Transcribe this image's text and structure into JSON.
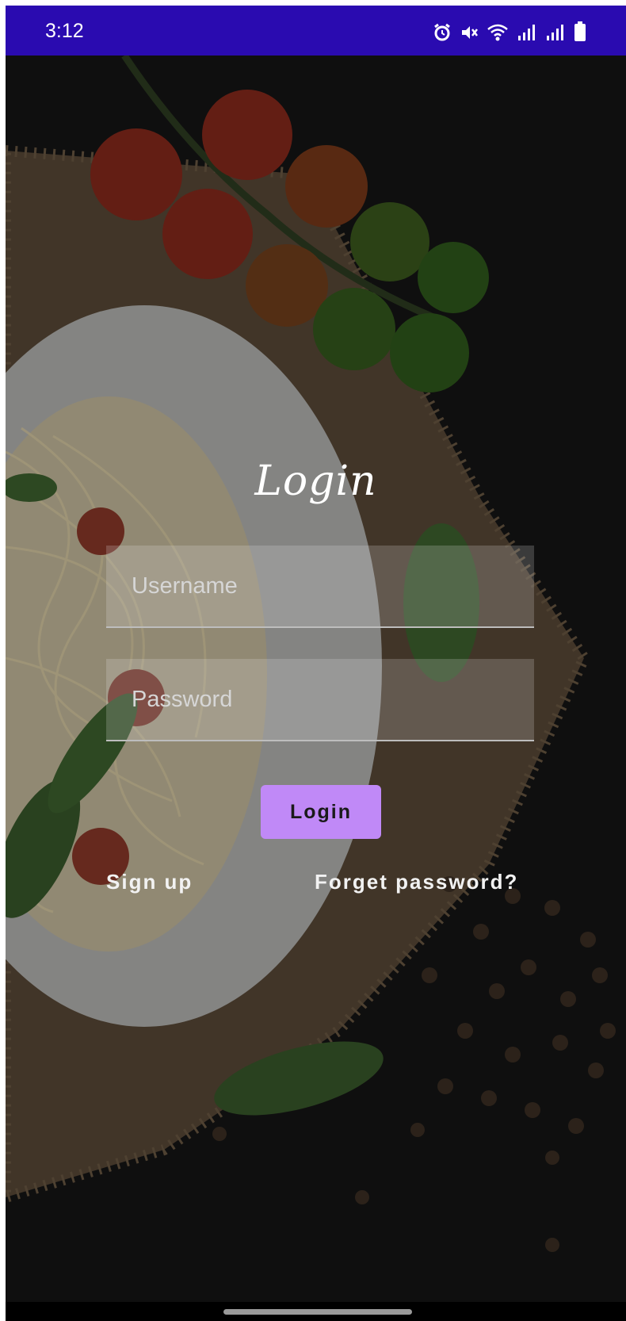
{
  "status_bar": {
    "time": "3:12",
    "icons": [
      "alarm-icon",
      "mute-icon",
      "wifi-icon",
      "signal-icon",
      "signal-icon",
      "battery-icon"
    ]
  },
  "login": {
    "title": "Login",
    "username_placeholder": "Username",
    "password_placeholder": "Password",
    "login_button": "Login",
    "sign_up": "Sign up",
    "forget_password": "Forget password?"
  },
  "colors": {
    "status_bar": "#2a0bb0",
    "background": "#151515",
    "button": "#c089f7"
  }
}
